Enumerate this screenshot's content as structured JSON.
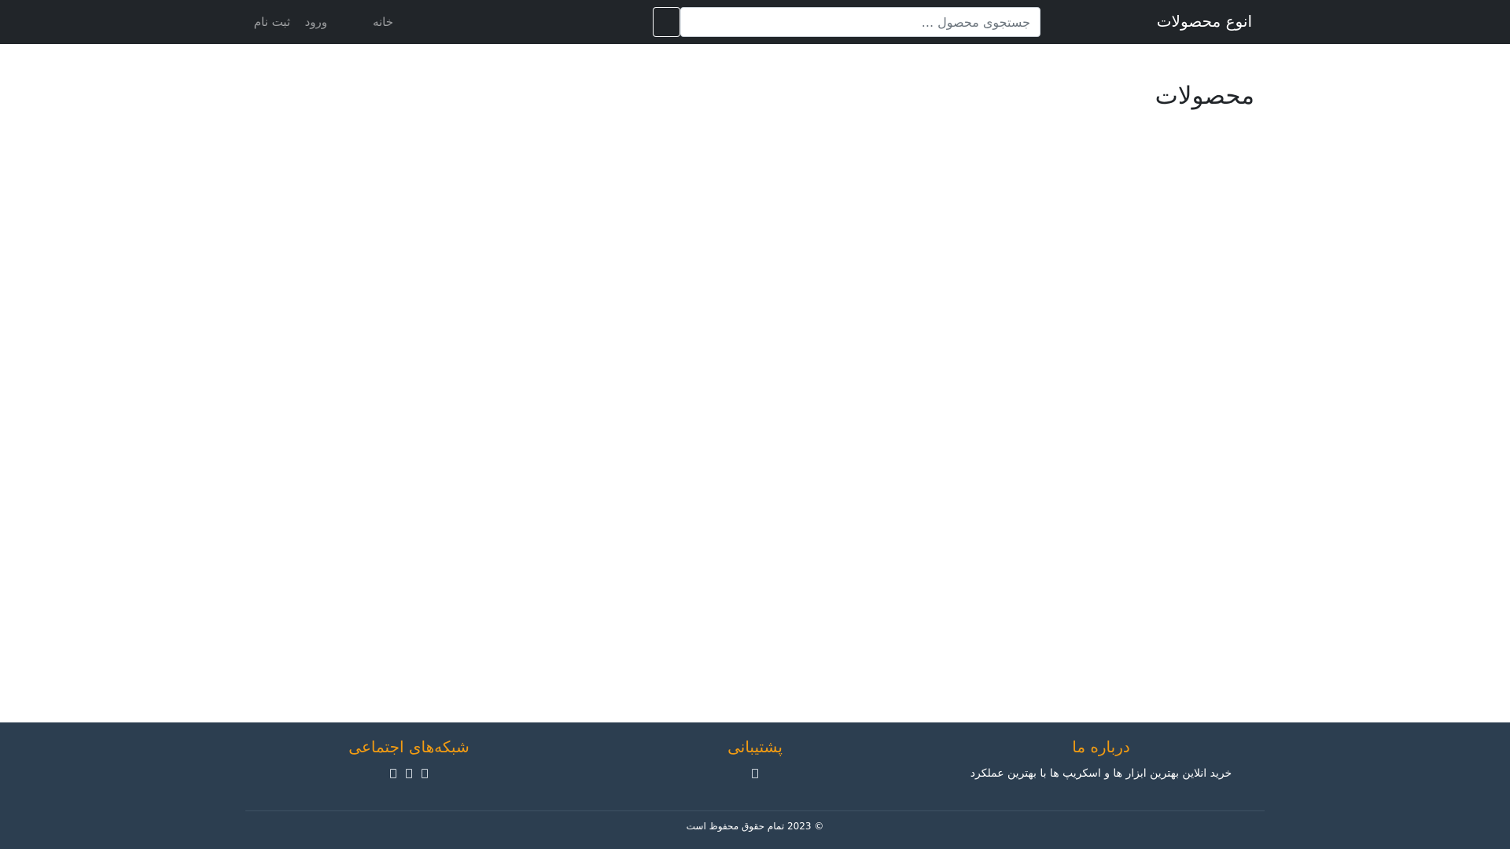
{
  "navbar": {
    "brand": "انوع محصولات",
    "search": {
      "placeholder": "جستجوی محصول ...",
      "button_icon": "search-icon"
    },
    "links": {
      "home": "خانه",
      "login": "ورود",
      "register": "ثبت نام"
    }
  },
  "main": {
    "title": "محصولات"
  },
  "footer": {
    "about": {
      "heading": "درباره ما",
      "text": "خرید انلاین بهترین ابزار ها و اسکریپ ها با بهترین عملکرد"
    },
    "support": {
      "heading": "پشتیبانی",
      "icons": [
        "support-icon"
      ]
    },
    "social": {
      "heading": "شبکه‌های اجتماعی",
      "icons": [
        "social-icon-1",
        "social-icon-2",
        "social-icon-3"
      ]
    },
    "copyright": "© 2023 تمام حقوق محفوظ است"
  },
  "colors": {
    "navbar_bg": "#212529",
    "footer_bg": "#2c3e50",
    "footer_heading": "#f39c12"
  }
}
